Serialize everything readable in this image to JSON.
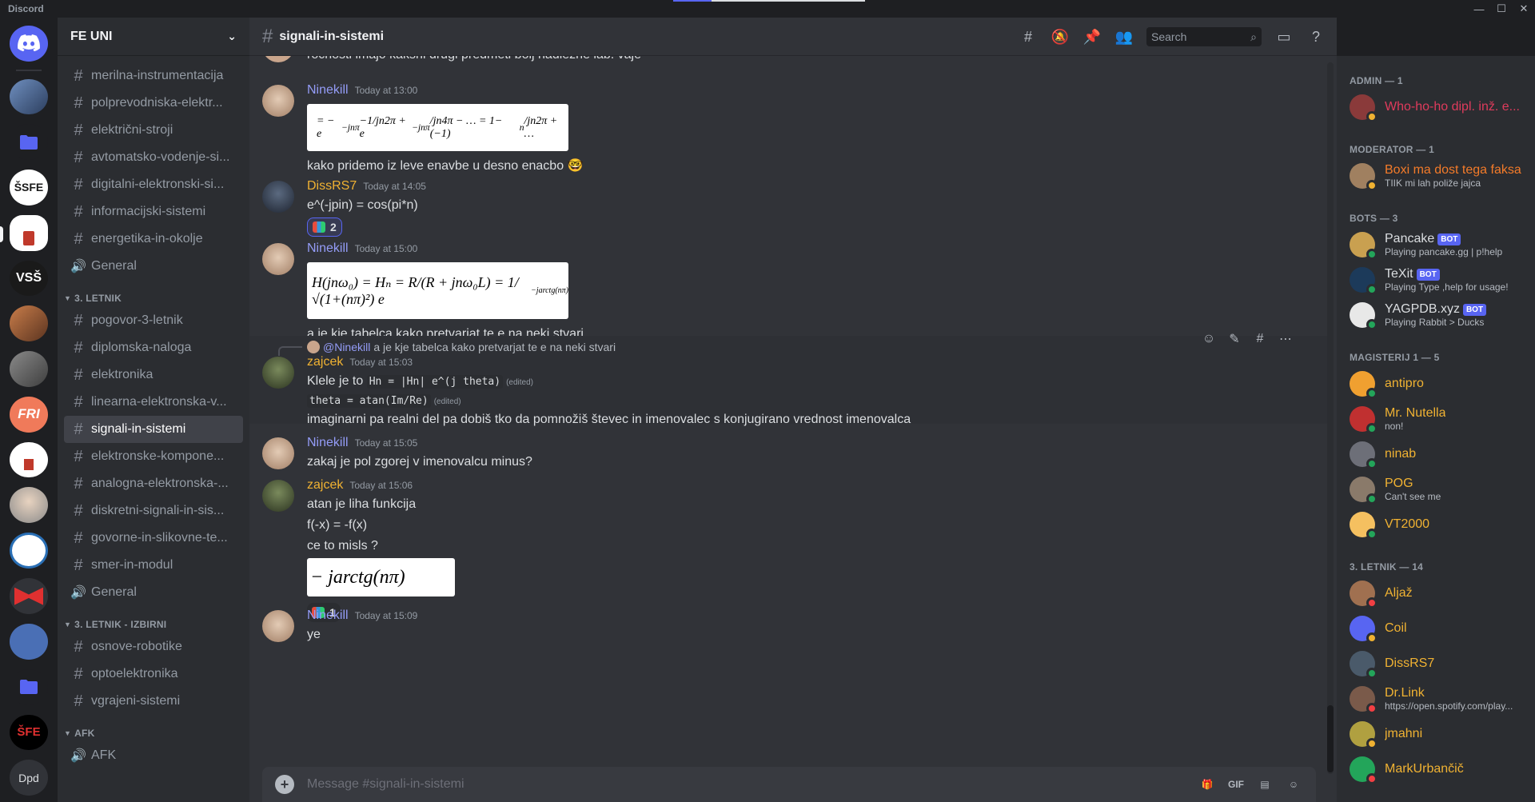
{
  "app": {
    "title": "Discord"
  },
  "window_controls": {
    "minimize": "—",
    "maximize": "☐",
    "close": "✕"
  },
  "guilds": [
    {
      "label": "",
      "color": "#5865f2",
      "icon": "discord-home-icon"
    },
    {
      "label": "",
      "color": "#3b5b8c",
      "icon": "server-avatar"
    },
    {
      "label": "",
      "color": "#1e1f22",
      "icon": "folder-icon"
    },
    {
      "label": "ŠSFE",
      "color": "#ffffff",
      "text_color": "#1a1a1a"
    },
    {
      "label": "",
      "color": "#ffffff",
      "active": true
    },
    {
      "label": "VSŠ",
      "color": "#1a1a1a"
    },
    {
      "label": "",
      "color": "#a0522d"
    },
    {
      "label": "",
      "color": "#6b6b6b"
    },
    {
      "label": "FRI",
      "color": "#f07a5a"
    },
    {
      "label": "",
      "color": "#ffffff"
    },
    {
      "label": "",
      "color": "#d8d8d8"
    },
    {
      "label": "",
      "color": "#ffffff"
    },
    {
      "label": "",
      "color": "#e03030"
    },
    {
      "label": "",
      "color": "#4a6fb5"
    },
    {
      "label": "",
      "color": "#1e1f22",
      "icon": "folder-icon"
    },
    {
      "label": "ŠFE",
      "color": "#000000",
      "text_color": "#e03030"
    },
    {
      "label": "Dpd",
      "color": "#313338"
    }
  ],
  "server": {
    "name": "FE UNI"
  },
  "channels": {
    "top": [
      {
        "name": "merilna-instrumentacija",
        "type": "text"
      },
      {
        "name": "polprevodniska-elektr...",
        "type": "text"
      },
      {
        "name": "električni-stroji",
        "type": "text"
      },
      {
        "name": "avtomatsko-vodenje-si...",
        "type": "text"
      },
      {
        "name": "digitalni-elektronski-si...",
        "type": "text"
      },
      {
        "name": "informacijski-sistemi",
        "type": "text"
      },
      {
        "name": "energetika-in-okolje",
        "type": "text"
      },
      {
        "name": "General",
        "type": "voice"
      }
    ],
    "cat1": {
      "name": "3. LETNIK"
    },
    "cat1_items": [
      {
        "name": "pogovor-3-letnik",
        "type": "text"
      },
      {
        "name": "diplomska-naloga",
        "type": "text"
      },
      {
        "name": "elektronika",
        "type": "text"
      },
      {
        "name": "linearna-elektronska-v...",
        "type": "text"
      },
      {
        "name": "signali-in-sistemi",
        "type": "text",
        "selected": true
      },
      {
        "name": "elektronske-kompone...",
        "type": "text"
      },
      {
        "name": "analogna-elektronska-...",
        "type": "text"
      },
      {
        "name": "diskretni-signali-in-sis...",
        "type": "text"
      },
      {
        "name": "govorne-in-slikovne-te...",
        "type": "text"
      },
      {
        "name": "smer-in-modul",
        "type": "text"
      },
      {
        "name": "General",
        "type": "voice"
      }
    ],
    "cat2": {
      "name": "3. LETNIK - IZBIRNI"
    },
    "cat2_items": [
      {
        "name": "osnove-robotike",
        "type": "text"
      },
      {
        "name": "optoelektronika",
        "type": "text"
      },
      {
        "name": "vgrajeni-sistemi",
        "type": "text"
      }
    ],
    "cat3": {
      "name": "AFK"
    },
    "cat3_items": [
      {
        "name": "AFK",
        "type": "voice"
      }
    ]
  },
  "chat": {
    "channel_name": "signali-in-sistemi",
    "search_placeholder": "Search",
    "top_partial_text": "ročnosti imajo kakšni drugi predmeti bolj nadležne lab. vaje",
    "messages": {
      "m1": {
        "author": "Ninekill",
        "time": "Today at 13:00",
        "text": "kako pridemo iz leve enavbe u desno enacbo"
      },
      "m2": {
        "author": "DissRS7",
        "time": "Today at 14:05",
        "text": "e^(-jpin) = cos(pi*n)",
        "reaction_count": "2"
      },
      "m3": {
        "author": "Ninekill",
        "time": "Today at 15:00",
        "text": "a je kje tabelca kako pretvarjat te e na neki stvari"
      },
      "m4": {
        "reply_mention": "@Ninekill",
        "reply_text": "a je kje tabelca kako pretvarjat te e na neki stvari",
        "author": "zajcek",
        "time": "Today at 15:03",
        "line1_prefix": "Klele je to",
        "line1_code": "Hn = |Hn| e^(j theta)",
        "line2_code": "theta = atan(Im/Re)",
        "edited": "(edited)",
        "line3": "imaginarni pa realni del pa dobiš tko da pomnožiš števec in imenovalec s konjugirano vrednost imenovalca"
      },
      "m5": {
        "author": "Ninekill",
        "time": "Today at 15:05",
        "text": "zakaj je pol zgorej v imenovalcu minus?"
      },
      "m6": {
        "author": "zajcek",
        "time": "Today at 15:06",
        "line1": "atan je liha funkcija",
        "line2": "f(-x) = -f(x)",
        "line3": "ce to misls ?",
        "reaction_count": "1"
      },
      "m7": {
        "author": "Ninekill",
        "time": "Today at 15:09",
        "text": "ye"
      }
    },
    "composer_placeholder": "Message #signali-in-sistemi",
    "composer_icons": {
      "gif": "GIF"
    }
  },
  "members": {
    "admin": {
      "title": "ADMIN — 1",
      "items": [
        {
          "name": "Who-ho-ho dipl. inž. e...",
          "color": "#e03b5c",
          "status": "idle"
        }
      ]
    },
    "moderator": {
      "title": "MODERATOR — 1",
      "items": [
        {
          "name": "Boxi ma dost tega faksa",
          "sub": "TIIK mi lah poliže jajca",
          "color": "#f47b29",
          "status": "idle"
        }
      ]
    },
    "bots": {
      "title": "BOTS — 3",
      "items": [
        {
          "name": "Pancake",
          "sub": "Playing pancake.gg | p!help",
          "tag": "BOT",
          "status": "online"
        },
        {
          "name": "TeXit",
          "sub": "Playing Type ,help for usage!",
          "tag": "BOT",
          "status": "online"
        },
        {
          "name": "YAGPDB.xyz",
          "sub": "Playing Rabbit > Ducks",
          "tag": "BOT",
          "status": "online"
        }
      ]
    },
    "magisterij": {
      "title": "MAGISTERIJ 1 — 5",
      "items": [
        {
          "name": "antipro",
          "color": "#f0b232",
          "status": "online"
        },
        {
          "name": "Mr. Nutella",
          "sub": "non!",
          "color": "#f0b232",
          "status": "online"
        },
        {
          "name": "ninab",
          "color": "#f0b232",
          "status": "online"
        },
        {
          "name": "POG",
          "sub": "Can't see me",
          "color": "#f0b232",
          "status": "online"
        },
        {
          "name": "VT2000",
          "color": "#f0b232",
          "status": "online"
        }
      ]
    },
    "letnik": {
      "title": "3. LETNIK — 14",
      "items": [
        {
          "name": "Aljaž",
          "color": "#f0b232",
          "status": "dnd"
        },
        {
          "name": "Coil",
          "color": "#f0b232",
          "status": "idle"
        },
        {
          "name": "DissRS7",
          "color": "#f0b232",
          "status": "online"
        },
        {
          "name": "Dr.Link",
          "sub": "https://open.spotify.com/play...",
          "color": "#f0b232",
          "status": "dnd"
        },
        {
          "name": "jmahni",
          "color": "#f0b232",
          "status": "idle"
        },
        {
          "name": "MarkUrbančič",
          "color": "#f0b232",
          "status": "dnd"
        }
      ]
    }
  },
  "colors": {
    "ninekill": "#949cf7",
    "dissrs7": "#f0b232",
    "zajcek": "#f0b232",
    "accent": "#5865f2"
  }
}
